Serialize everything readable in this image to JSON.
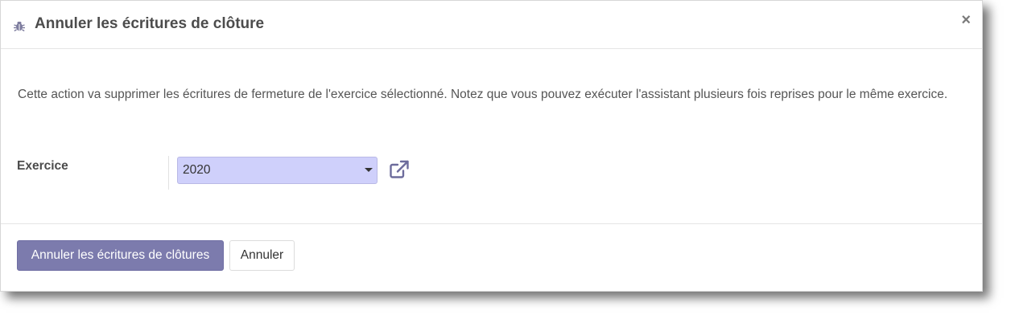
{
  "dialog": {
    "title": "Annuler les écritures de clôture",
    "close_label": "×",
    "description": "Cette action va supprimer les écritures de fermeture de l'exercice sélectionné. Notez que vous pouvez exécuter l'assistant plusieurs fois reprises pour le même exercice."
  },
  "form": {
    "fiscal_year": {
      "label": "Exercice",
      "value": "2020"
    }
  },
  "footer": {
    "confirm_label": "Annuler les écritures de clôtures",
    "cancel_label": "Annuler"
  },
  "icons": {
    "header": "bug-icon",
    "close": "close-icon",
    "dropdown": "chevron-down-icon",
    "external": "external-link-icon"
  },
  "colors": {
    "primary_button": "#7c7bad",
    "select_background": "#cfd0fb",
    "icon_accent": "#6d6c9c"
  }
}
